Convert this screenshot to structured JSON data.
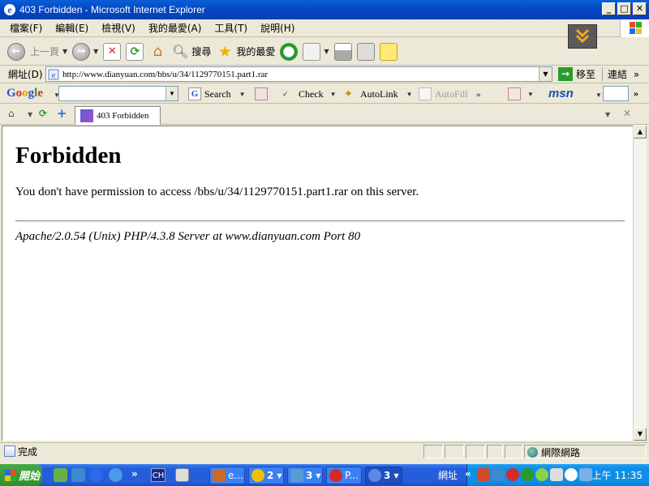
{
  "window": {
    "title": "403 Forbidden - Microsoft Internet Explorer"
  },
  "menu": [
    "檔案(F)",
    "編輯(E)",
    "檢視(V)",
    "我的最愛(A)",
    "工具(T)",
    "說明(H)"
  ],
  "toolbar": {
    "back_label": "上一頁",
    "search_label": "搜尋",
    "favorites_label": "我的最愛"
  },
  "address": {
    "label": "網址(D)",
    "url": "http://www.dianyuan.com/bbs/u/34/1129770151.part1.rar",
    "go_label": "移至",
    "links_label": "連結"
  },
  "google_bar": {
    "logo": [
      "G",
      "o",
      "o",
      "g",
      "l",
      "e"
    ],
    "search_label": "Search",
    "check_label": "Check",
    "autolink_label": "AutoLink",
    "autofill_label": "AutoFill",
    "msn_label": "msn"
  },
  "tab": {
    "title": "403 Forbidden"
  },
  "page": {
    "heading": "Forbidden",
    "message": "You don't have permission to access /bbs/u/34/1129770151.part1.rar on this server.",
    "server_signature": "Apache/2.0.54 (Unix) PHP/4.3.8 Server at www.dianyuan.com Port 80"
  },
  "status": {
    "text": "完成",
    "zone": "網際網路"
  },
  "taskbar": {
    "start_label": "開始",
    "ch_label": "CH",
    "buttons": [
      "e...",
      "2",
      "3",
      "P...",
      "3"
    ],
    "address_label": "網址",
    "clock": "上午 11:35"
  }
}
